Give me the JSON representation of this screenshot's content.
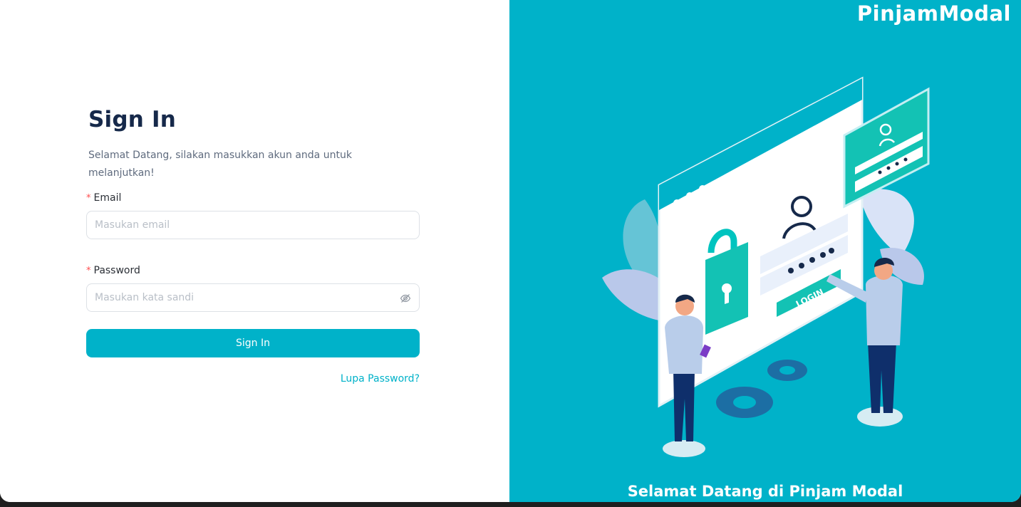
{
  "signin": {
    "title": "Sign In",
    "subtitle": "Selamat Datang, silakan masukkan akun anda untuk melanjutkan!",
    "email_label": "Email",
    "email_placeholder": "Masukan email",
    "password_label": "Password",
    "password_placeholder": "Masukan kata sandi",
    "required_mark": "*",
    "submit_label": "Sign In",
    "forgot_label": "Lupa Password?"
  },
  "brand": {
    "logo_text": "PinjamModal",
    "welcome_text": "Selamat Datang di Pinjam Modal",
    "illustration_button_text": "LOGIN"
  },
  "colors": {
    "accent": "#00b2c9",
    "title": "#16294a",
    "required": "#ff4d4f"
  },
  "icons": {
    "password_toggle": "eye-slash-icon"
  }
}
